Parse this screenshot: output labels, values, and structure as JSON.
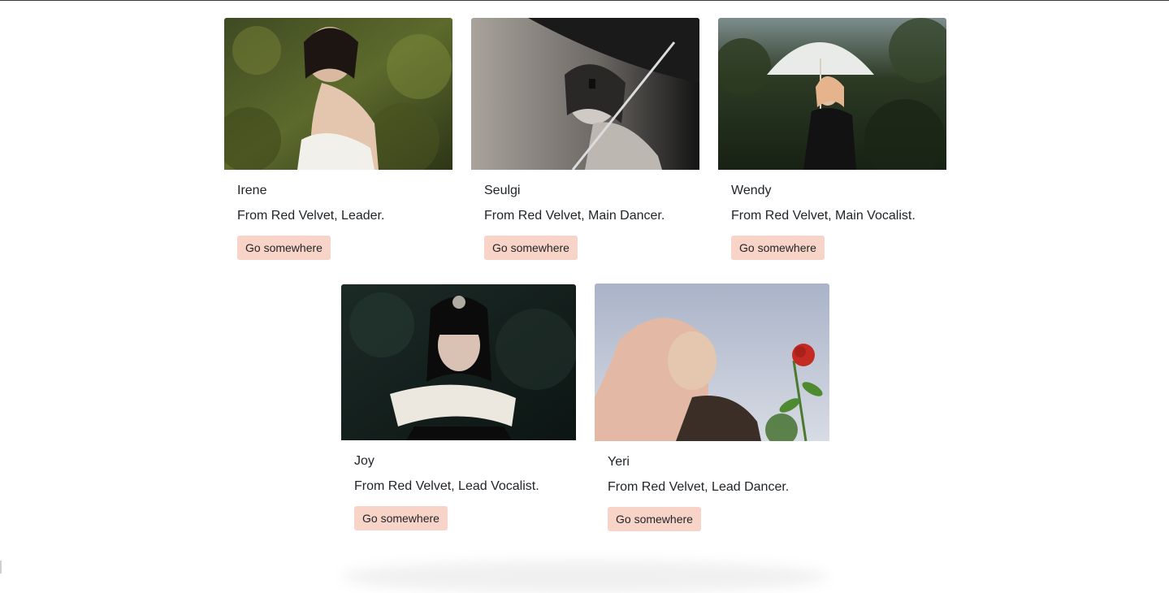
{
  "cards": [
    {
      "title": "Irene",
      "text": "From Red Velvet, Leader.",
      "button_label": "Go somewhere",
      "image_alt": "photo-irene"
    },
    {
      "title": "Seulgi",
      "text": "From Red Velvet, Main Dancer.",
      "button_label": "Go somewhere",
      "image_alt": "photo-seulgi"
    },
    {
      "title": "Wendy",
      "text": "From Red Velvet, Main Vocalist.",
      "button_label": "Go somewhere",
      "image_alt": "photo-wendy"
    },
    {
      "title": "Joy",
      "text": "From Red Velvet, Lead Vocalist.",
      "button_label": "Go somewhere",
      "image_alt": "photo-joy"
    },
    {
      "title": "Yeri",
      "text": "From Red Velvet, Lead Dancer.",
      "button_label": "Go somewhere",
      "image_alt": "photo-yeri"
    }
  ],
  "colors": {
    "button_bg": "#f8d4c8",
    "text": "#212529"
  }
}
